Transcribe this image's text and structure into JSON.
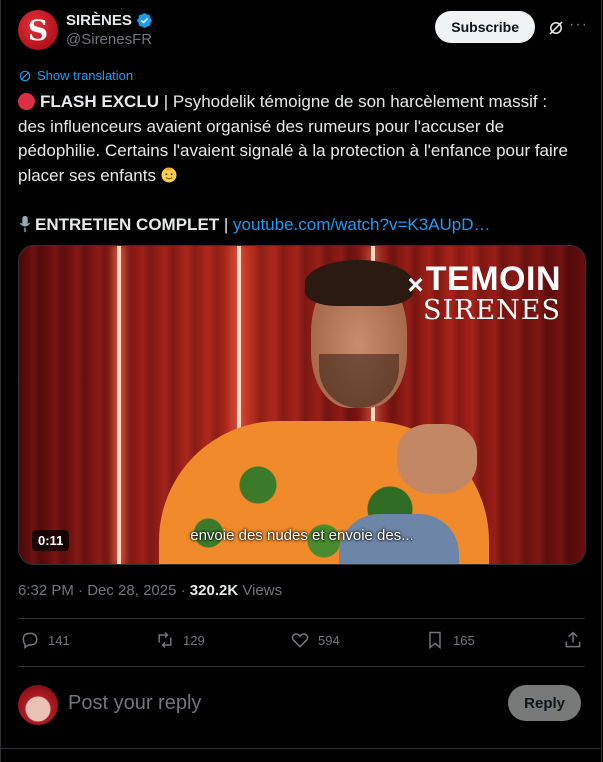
{
  "author": {
    "display_name": "SIRÈNES",
    "handle": "@SirenesFR",
    "avatar_letter": "S",
    "verified": true
  },
  "header": {
    "subscribe_label": "Subscribe",
    "more_label": "···"
  },
  "translation": {
    "label": "Show translation"
  },
  "tweet": {
    "headline": "FLASH EXCLU",
    "body": " | Psyhodelik témoigne de son harcèlement massif : des influenceurs avaient organisé des rumeurs pour l'accuser de pédophilie. Certains l'avaient signalé à la protection à l'enfance pour faire placer ses enfants",
    "interview_label": "ENTRETIEN COMPLET",
    "separator": " | ",
    "link_text": "youtube.com/watch?v=K3AUpD…"
  },
  "media": {
    "watermark_x": "×",
    "watermark_line1": "TEMOIN",
    "watermark_line2": "SIRENES",
    "caption": "envoie des nudes et envoie des...",
    "duration": "0:11"
  },
  "meta": {
    "time": "6:32 PM",
    "dot1": " · ",
    "date": "Dec 28, 2025",
    "dot2": " · ",
    "views_count": "320.2K",
    "views_label": " Views"
  },
  "actions": {
    "replies": "141",
    "reposts": "129",
    "likes": "594",
    "bookmarks": "165"
  },
  "reply": {
    "placeholder": "Post your reply",
    "button_label": "Reply"
  },
  "colors": {
    "accent": "#1d9bf0",
    "background": "#000000",
    "muted": "#71767b",
    "brand_red": "#dd2e44"
  }
}
